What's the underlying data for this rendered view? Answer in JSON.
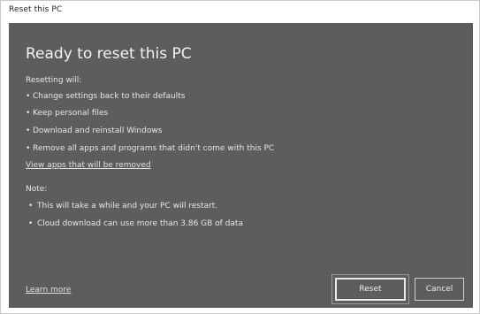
{
  "window": {
    "title": "Reset this PC"
  },
  "dialog": {
    "heading": "Ready to reset this PC",
    "resetting_label": "Resetting will:",
    "resetting_items": [
      "Change settings back to their defaults",
      "Keep personal files",
      "Download and reinstall Windows",
      "Remove all apps and programs that didn't come with this PC"
    ],
    "view_apps_link": "View apps that will be removed",
    "note_label": "Note:",
    "note_items": [
      "This will take a while and your PC will restart.",
      "Cloud download can use more than 3.86 GB of data"
    ],
    "learn_more_link": "Learn more",
    "reset_button": "Reset",
    "cancel_button": "Cancel"
  },
  "colors": {
    "panel_background": "#5d5d5d",
    "text": "#e6e6e6",
    "button_border": "#e9e9e9"
  }
}
